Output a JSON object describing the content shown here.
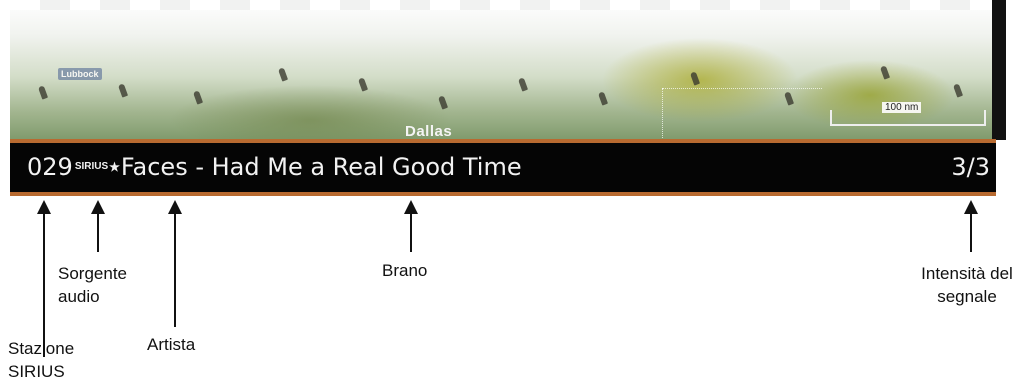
{
  "map": {
    "cities": {
      "lubbock": "Lubbock",
      "dallas": "Dallas"
    },
    "scale": "100 nm"
  },
  "info_bar": {
    "station": "029",
    "audio_source_logo": "SIRIUS",
    "artist": "Faces",
    "separator": " - ",
    "song": "Had Me a Real Good Time",
    "signal": "3/3"
  },
  "labels": {
    "station": "Stazione SIRIUS",
    "audio_source": "Sorgente audio",
    "artist": "Artista",
    "song": "Brano",
    "signal": "Intensità del segnale"
  },
  "colors": {
    "bar_background": "#050505",
    "bar_border": "#b86a30",
    "bar_text": "#f2f2f2"
  }
}
